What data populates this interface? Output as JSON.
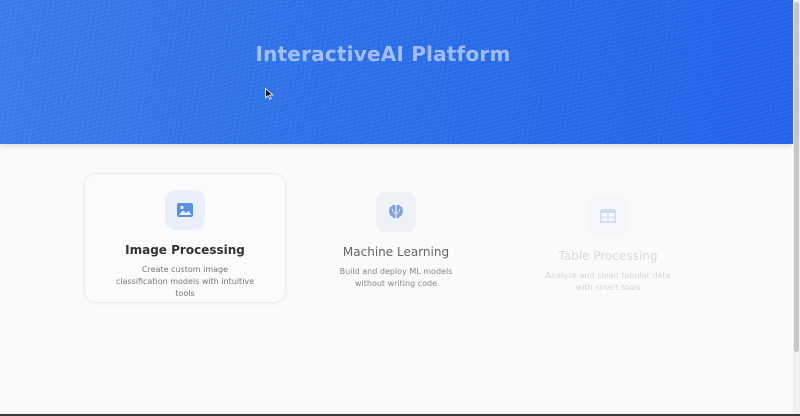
{
  "hero": {
    "title": "InteractiveAI Platform"
  },
  "cards": [
    {
      "title": "Image Processing",
      "description": "Create custom image classification models with intuitive tools",
      "icon": "image-icon"
    },
    {
      "title": "Machine Learning",
      "description": "Build and deploy ML models without writing code",
      "icon": "brain-icon"
    },
    {
      "title": "Table Processing",
      "description": "Analyze and clean tabular data with smart tools",
      "icon": "table-icon"
    }
  ],
  "colors": {
    "hero_blue": "#2a6ee8",
    "accent_icon": "#5b8fe0",
    "page_bg": "#fafafa"
  }
}
